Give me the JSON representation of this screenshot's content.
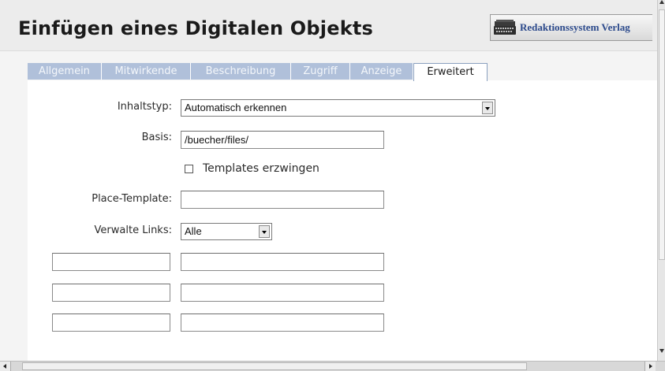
{
  "header": {
    "title": "Einfügen eines Digitalen Objekts",
    "brand_label": "Redaktionssystem Verlag",
    "brand_icon": "typewriter-icon"
  },
  "tabs": [
    {
      "label": "Allgemein",
      "active": false
    },
    {
      "label": "Mitwirkende",
      "active": false
    },
    {
      "label": "Beschreibung",
      "active": false
    },
    {
      "label": "Zugriff",
      "active": false
    },
    {
      "label": "Anzeige",
      "active": false
    },
    {
      "label": "Erweitert",
      "active": true
    }
  ],
  "form": {
    "content_type": {
      "label": "Inhaltstyp:",
      "value": "Automatisch erkennen"
    },
    "base": {
      "label": "Basis:",
      "value": "/buecher/files/"
    },
    "force_templates": {
      "label": "Templates erzwingen",
      "checked": false
    },
    "place_template": {
      "label": "Place-Template:",
      "value": ""
    },
    "manage_links": {
      "label": "Verwalte Links:",
      "value": "Alle"
    },
    "extra_rows": [
      {
        "key": "",
        "value": ""
      },
      {
        "key": "",
        "value": ""
      },
      {
        "key": "",
        "value": ""
      }
    ]
  },
  "colors": {
    "tab_inactive": "#b0c0da",
    "tab_text_inactive": "#f4f7fb",
    "brand_text": "#2c4a8c"
  }
}
